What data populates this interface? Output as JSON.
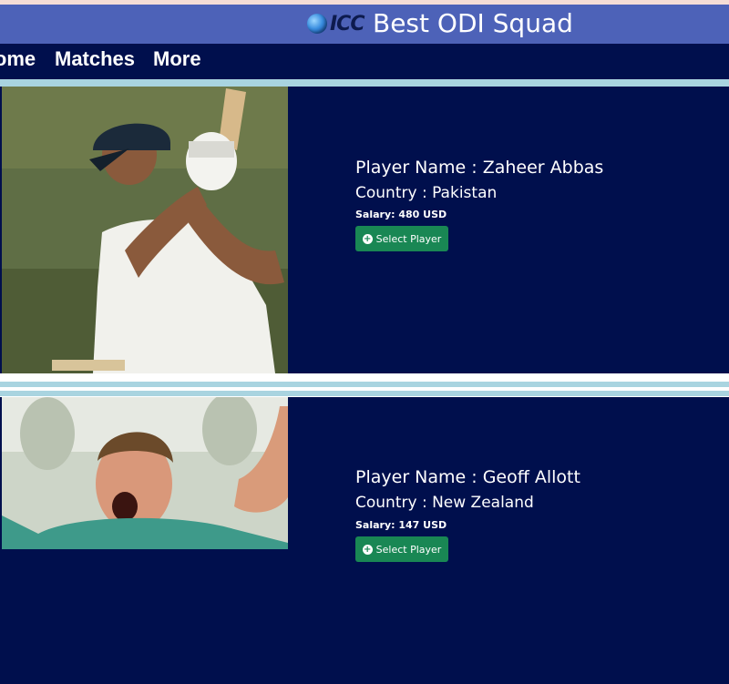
{
  "header": {
    "logo_text": "ICC",
    "title": "Best ODI Squad"
  },
  "nav": {
    "items": [
      {
        "label": "Home"
      },
      {
        "label": "Matches"
      },
      {
        "label": "More"
      }
    ]
  },
  "players": [
    {
      "name_line": "Player Name : Zaheer Abbas",
      "country_line": "Country : Pakistan",
      "salary_line": "Salary: 480 USD",
      "button_label": "Select Player"
    },
    {
      "name_line": "Player Name : Geoff Allott",
      "country_line": "Country : New Zealand",
      "salary_line": "Salary: 147 USD",
      "button_label": "Select Player"
    }
  ],
  "colors": {
    "title_bar": "#4d62b8",
    "nav_bar": "#000f4d",
    "card_bg": "#000f4d",
    "separator": "#a9d4e0",
    "button": "#198754"
  },
  "icons": {
    "logo": "cricket-ball-icon",
    "button": "plus-circle-icon"
  }
}
